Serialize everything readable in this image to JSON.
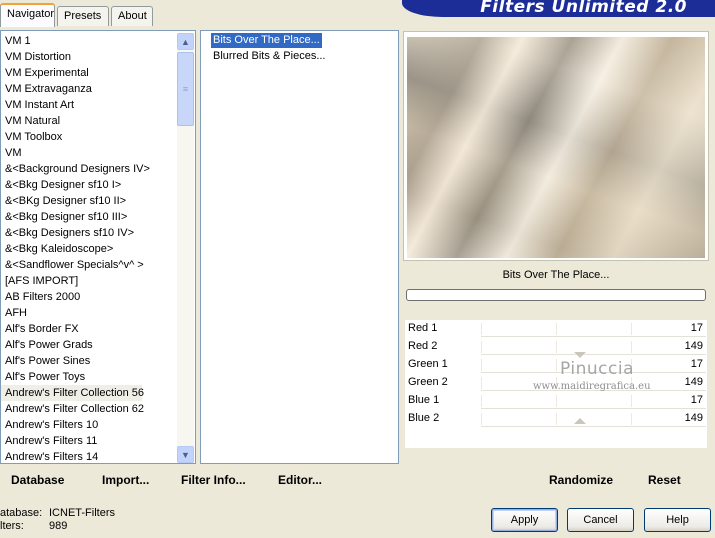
{
  "tabs": [
    "Navigator",
    "Presets",
    "About"
  ],
  "logo": "Filters Unlimited 2.0",
  "categories": [
    "VM 1",
    "VM Distortion",
    "VM Experimental",
    "VM Extravaganza",
    "VM Instant Art",
    "VM Natural",
    "VM Toolbox",
    "VM",
    "&<Background Designers IV>",
    "&<Bkg Designer sf10 I>",
    "&<BKg Designer sf10 II>",
    "&<Bkg Designer sf10 III>",
    "&<Bkg Designers sf10 IV>",
    "&<Bkg Kaleidoscope>",
    "&<Sandflower Specials^v^ >",
    "[AFS IMPORT]",
    "AB Filters 2000",
    "AFH",
    "Alf's Border FX",
    "Alf's Power Grads",
    "Alf's Power Sines",
    "Alf's Power Toys",
    "Andrew's Filter Collection 56",
    "Andrew's Filter Collection 62",
    "Andrew's Filters 10",
    "Andrew's Filters 11",
    "Andrew's Filters 14"
  ],
  "selected_category_index": 22,
  "filters": [
    "Bits Over The Place...",
    "Blurred Bits & Pieces..."
  ],
  "selected_filter_index": 0,
  "filter_title": "Bits Over The Place...",
  "params": [
    {
      "label": "Red 1",
      "value": "17"
    },
    {
      "label": "Red 2",
      "value": "149"
    },
    {
      "label": "Green 1",
      "value": "17"
    },
    {
      "label": "Green 2",
      "value": "149"
    },
    {
      "label": "Blue 1",
      "value": "17"
    },
    {
      "label": "Blue 2",
      "value": "149"
    }
  ],
  "watermark": {
    "name": "Pinuccia",
    "site": "www.maidiregrafica.eu"
  },
  "toolbar": {
    "database": "Database",
    "import": "Import...",
    "filter_info": "Filter Info...",
    "editor": "Editor...",
    "randomize": "Randomize",
    "reset": "Reset"
  },
  "status": {
    "db_label": "atabase:",
    "db_value": "ICNET-Filters",
    "filters_label": "lters:",
    "filters_value": "989"
  },
  "buttons": {
    "apply": "Apply",
    "cancel": "Cancel",
    "help": "Help"
  },
  "colors": {
    "selection": "#316ac5",
    "logo_bg": "#1c2d98",
    "window_bg": "#ece9d8"
  }
}
